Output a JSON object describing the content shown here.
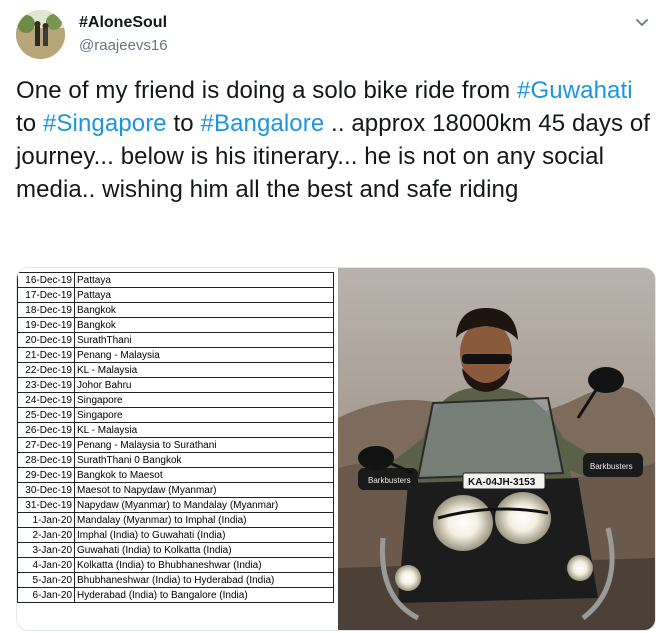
{
  "user": {
    "name": "#AloneSoul",
    "handle": "@raajeevs16"
  },
  "tweet": {
    "t1": "One of my friend is doing a solo bike ride from ",
    "h1": "#Guwahati",
    "t2": " to ",
    "h2": "#Singapore",
    "t3": " to ",
    "h3": "#Bangalore",
    "t4": " .. approx 18000km 45 days of journey... below is his itinerary... he is not on any social media.. wishing him all the best and safe riding"
  },
  "itinerary": [
    {
      "date": "16-Dec-19",
      "place": "Pattaya"
    },
    {
      "date": "17-Dec-19",
      "place": "Pattaya"
    },
    {
      "date": "18-Dec-19",
      "place": "Bangkok"
    },
    {
      "date": "19-Dec-19",
      "place": "Bangkok"
    },
    {
      "date": "20-Dec-19",
      "place": "SurathThani"
    },
    {
      "date": "21-Dec-19",
      "place": "Penang - Malaysia"
    },
    {
      "date": "22-Dec-19",
      "place": "KL - Malaysia"
    },
    {
      "date": "23-Dec-19",
      "place": "Johor Bahru"
    },
    {
      "date": "24-Dec-19",
      "place": "Singapore"
    },
    {
      "date": "25-Dec-19",
      "place": "Singapore"
    },
    {
      "date": "26-Dec-19",
      "place": "KL - Malaysia"
    },
    {
      "date": "27-Dec-19",
      "place": "Penang - Malaysia to Surathani"
    },
    {
      "date": "28-Dec-19",
      "place": "SurathThani 0 Bangkok"
    },
    {
      "date": "29-Dec-19",
      "place": "Bangkok to Maesot"
    },
    {
      "date": "30-Dec-19",
      "place": "Maesot to Napydaw (Myanmar)"
    },
    {
      "date": "31-Dec-19",
      "place": "Napydaw (Myanmar) to Mandalay (Myanmar)"
    },
    {
      "date": "1-Jan-20",
      "place": "Mandalay (Myanmar) to Imphal (India)"
    },
    {
      "date": "2-Jan-20",
      "place": "Imphal (India) to Guwahati (India)"
    },
    {
      "date": "3-Jan-20",
      "place": "Guwahati (India) to Kolkatta (India)"
    },
    {
      "date": "4-Jan-20",
      "place": "Kolkatta (India) to Bhubhaneshwar (India)"
    },
    {
      "date": "5-Jan-20",
      "place": "Bhubhaneshwar (India) to Hyderabad (India)"
    },
    {
      "date": "6-Jan-20",
      "place": "Hyderabad (India) to Bangalore (India)"
    }
  ],
  "photo": {
    "plate": "KA-04JH-3153",
    "guard_brand": "Barkbusters"
  },
  "colors": {
    "hashtag": "#1b95e0",
    "secondary_text": "#657786",
    "primary_text": "#14171a"
  },
  "icons": {
    "menu": "chevron-down-icon"
  }
}
